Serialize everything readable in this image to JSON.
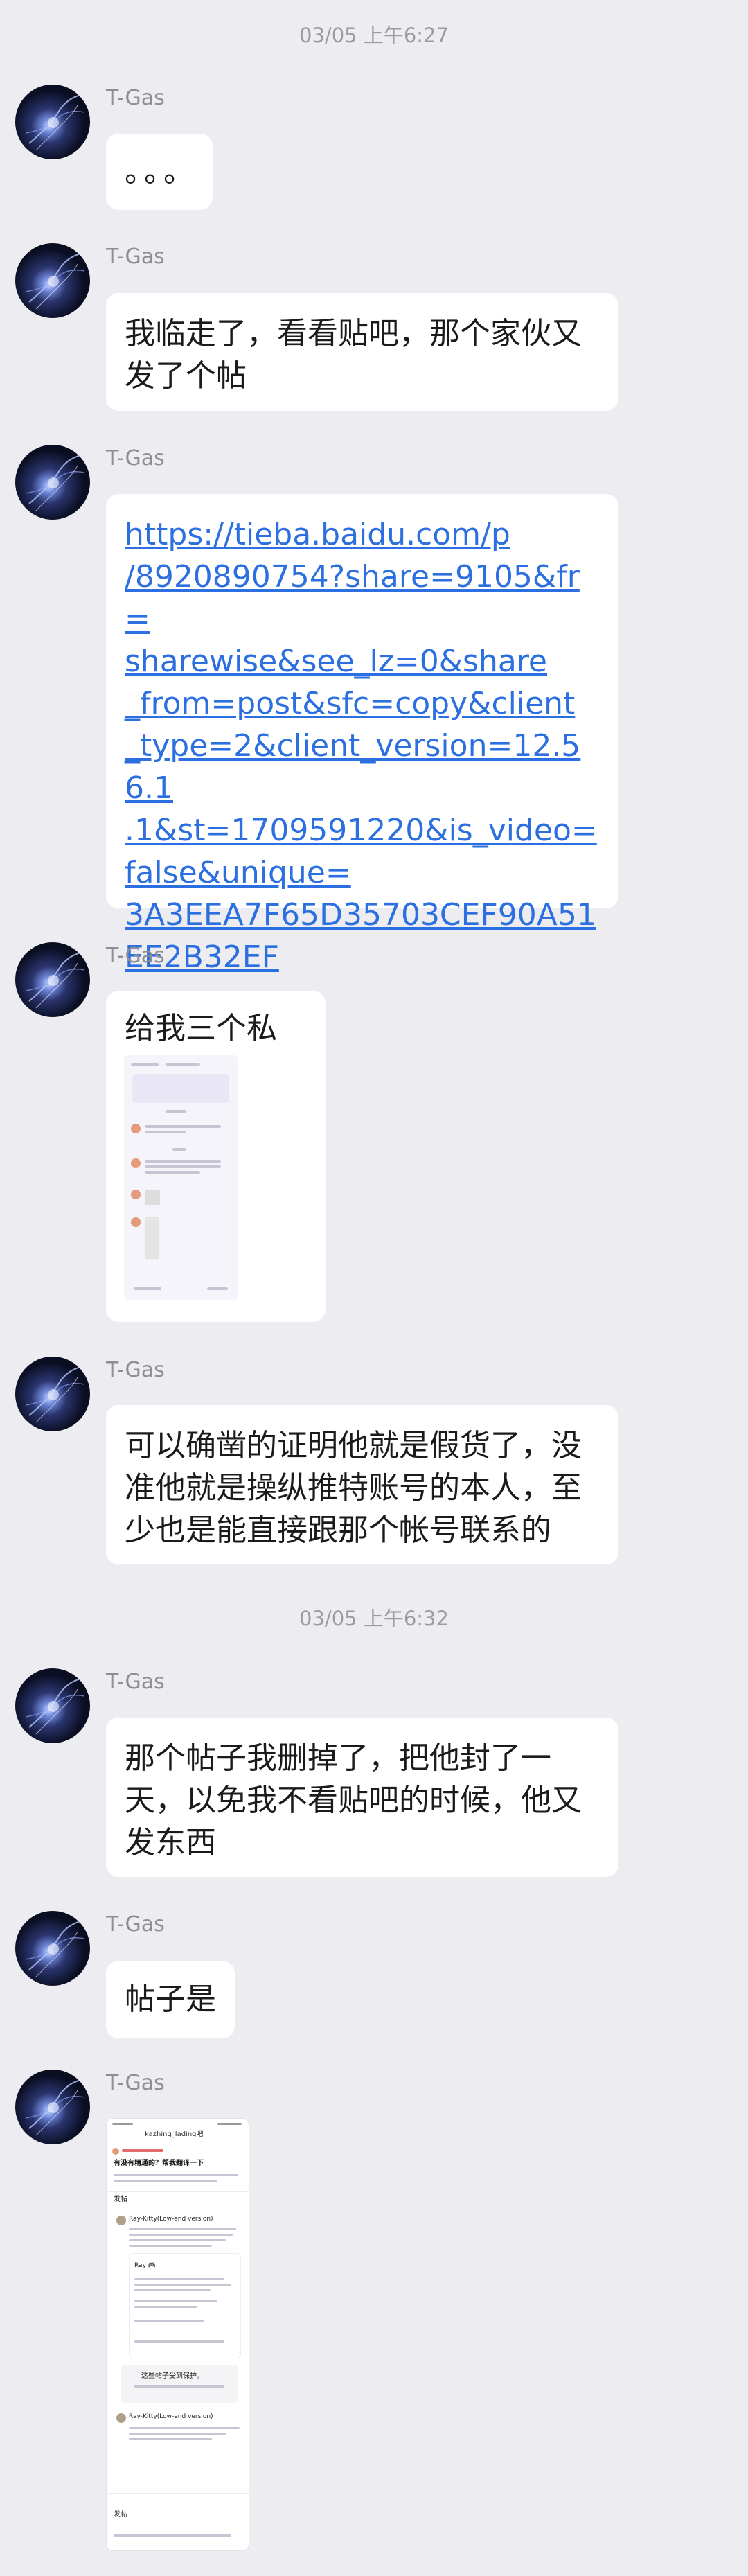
{
  "timestamps": [
    "03/05 上午6:27",
    "03/05 上午6:32"
  ],
  "sender": "T-Gas",
  "messages": [
    {
      "type": "text",
      "text": "。。。"
    },
    {
      "type": "text",
      "lines": [
        "我临走了，看看贴吧，那个家伙又",
        "发了个帖"
      ]
    },
    {
      "type": "link",
      "lines": [
        "https://tieba.baidu.com/p",
        "/8920890754?share=9105&fr=",
        "sharewise&see_lz=0&share",
        "_from=post&sfc=copy&client",
        "_type=2&client_version=12.56.1",
        ".1&st=1709591220&is_video=",
        "false&unique=",
        "3A3EEA7F65D35703CEF90A51",
        "EE2B32EF"
      ]
    },
    {
      "type": "text_image",
      "text": "给我三个私信"
    },
    {
      "type": "text",
      "lines": [
        "可以确凿的证明他就是假货了，没",
        "准他就是操纵推特账号的本人，至",
        "少也是能直接跟那个帐号联系的"
      ]
    },
    {
      "type": "text",
      "lines": [
        "那个帖子我删掉了，把他封了一",
        "天，以免我不看贴吧的时候，他又",
        "发东西"
      ]
    },
    {
      "type": "text",
      "text": "帖子是"
    },
    {
      "type": "image"
    }
  ],
  "screenshot2": {
    "forum": "kazhing_lading吧",
    "question": "有没有精通的？帮我翻译一下",
    "reply_title": "发帖",
    "user_a": "Ray-Kitty(Low-end version)",
    "user_b": "Ray 🎮",
    "banner": "这些帖子受到保护。",
    "user_c": "Ray-Kitty(Low-end version)",
    "reply_title2": "发帖"
  },
  "colors": {
    "background": "#ededf1",
    "bubble": "#ffffff",
    "link": "#2b6fe0",
    "name": "#8e8e93"
  }
}
